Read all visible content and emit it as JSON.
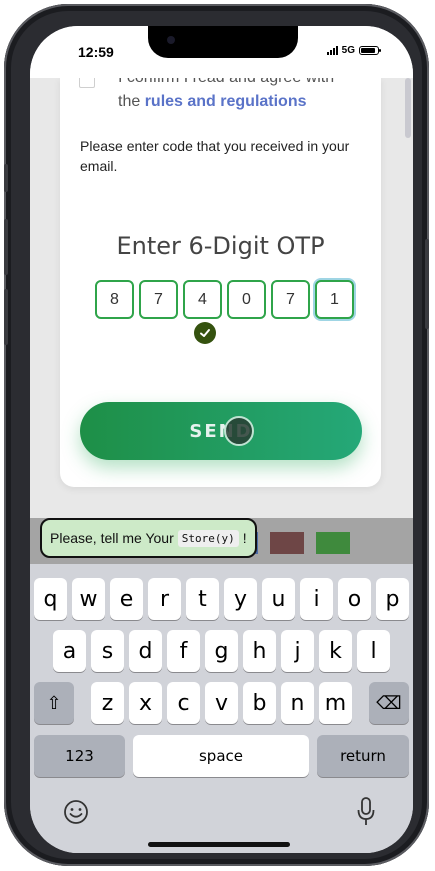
{
  "status": {
    "time": "12:59",
    "network": "5G"
  },
  "form": {
    "agree_text": "I confirm I read and agree with",
    "rules_link": "rules and regulations",
    "instruction": "Please enter code that you received in your email.",
    "otp_title": "Enter 6-Digit OTP",
    "otp_digits": [
      "8",
      "7",
      "4",
      "0",
      "7",
      "1"
    ],
    "send_label": "SEND"
  },
  "tooltip": {
    "prefix": "Please, tell me Your",
    "code": "Store(y)",
    "suffix": "!"
  },
  "hint_colors": [
    "#6e4646",
    "#3f8a3d",
    "#4a6aa8"
  ],
  "keyboard": {
    "row1": [
      "q",
      "w",
      "e",
      "r",
      "t",
      "y",
      "u",
      "i",
      "o",
      "p"
    ],
    "row2": [
      "a",
      "s",
      "d",
      "f",
      "g",
      "h",
      "j",
      "k",
      "l"
    ],
    "row3": [
      "z",
      "x",
      "c",
      "v",
      "b",
      "n",
      "m"
    ],
    "shift_label": "⇧",
    "delete_label": "⌫",
    "numbers_label": "123",
    "space_label": "space",
    "return_label": "return"
  },
  "icons": {
    "emoji": "emoji-icon",
    "mic": "microphone-icon",
    "check": "check-circle-icon"
  }
}
